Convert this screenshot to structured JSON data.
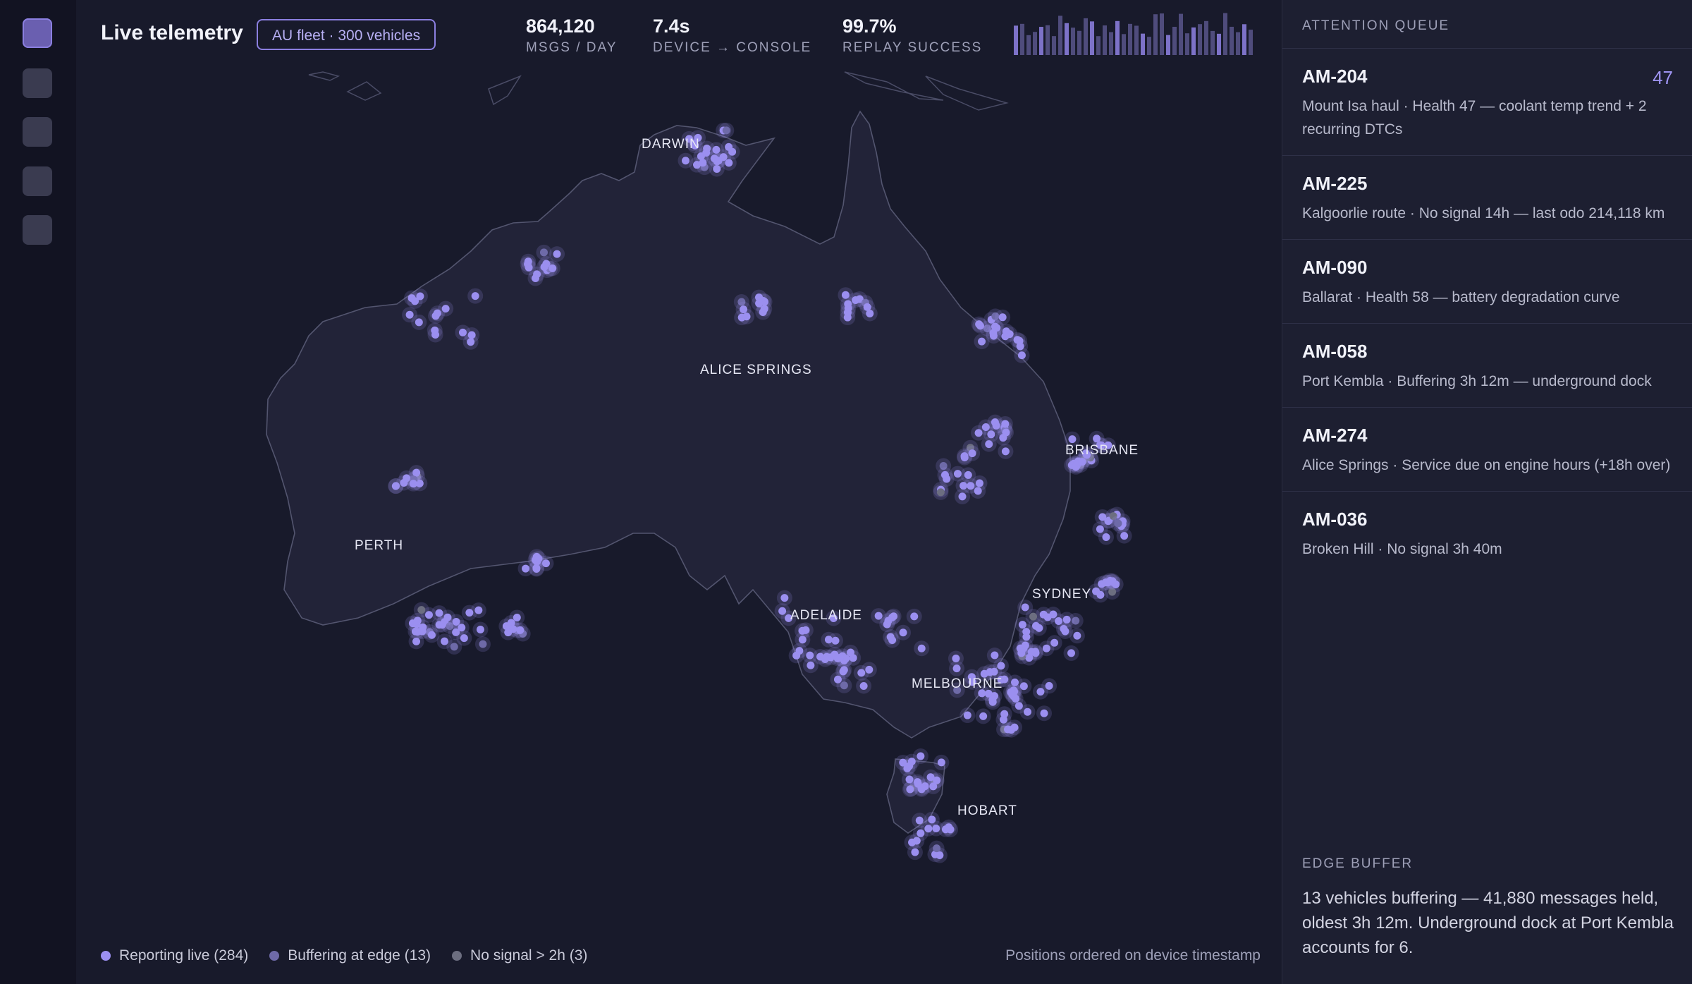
{
  "header": {
    "title": "Live telemetry",
    "fleet_pill": "AU fleet · 300 vehicles",
    "stats": [
      {
        "value": "864,120",
        "label": "MSGS / DAY"
      },
      {
        "value": "7.4s",
        "label": "DEVICE → CONSOLE"
      },
      {
        "value": "99.7%",
        "label": "REPLAY SUCCESS"
      }
    ]
  },
  "sidebar": {
    "icons": [
      "fleet-map-icon",
      "nav-icon-2",
      "nav-icon-3",
      "nav-icon-4",
      "nav-icon-5"
    ]
  },
  "map": {
    "cities": [
      "DARWIN",
      "ALICE SPRINGS",
      "BRISBANE",
      "PERTH",
      "SYDNEY",
      "ADELAIDE",
      "MELBOURNE",
      "HOBART"
    ]
  },
  "legend": {
    "live": "Reporting live (284)",
    "buffering": "Buffering at edge (13)",
    "no_signal": "No signal > 2h (3)",
    "note": "Positions ordered on device timestamp"
  },
  "colors": {
    "live": "#9b8ff0",
    "buffering": "#6e6aa8",
    "no_signal": "#6c6e80",
    "accent": "#8b7fe0"
  },
  "attention": {
    "heading": "ATTENTION QUEUE",
    "items": [
      {
        "id": "AM-204",
        "score": "47",
        "desc": "Mount Isa haul · Health 47 — coolant temp trend + 2 recurring DTCs"
      },
      {
        "id": "AM-225",
        "score": "",
        "desc": "Kalgoorlie route · No signal 14h — last odo 214,118 km"
      },
      {
        "id": "AM-090",
        "score": "",
        "desc": "Ballarat · Health 58 — battery degradation curve"
      },
      {
        "id": "AM-058",
        "score": "",
        "desc": "Port Kembla · Buffering 3h 12m — underground dock"
      },
      {
        "id": "AM-274",
        "score": "",
        "desc": "Alice Springs · Service due on engine hours (+18h over)"
      },
      {
        "id": "AM-036",
        "score": "",
        "desc": "Broken Hill · No signal 3h 40m"
      }
    ]
  },
  "edge_buffer": {
    "heading": "EDGE BUFFER",
    "text": "13 vehicles buffering — 41,880 messages held, oldest 3h 12m. Underground dock at Port Kembla accounts for 6."
  }
}
